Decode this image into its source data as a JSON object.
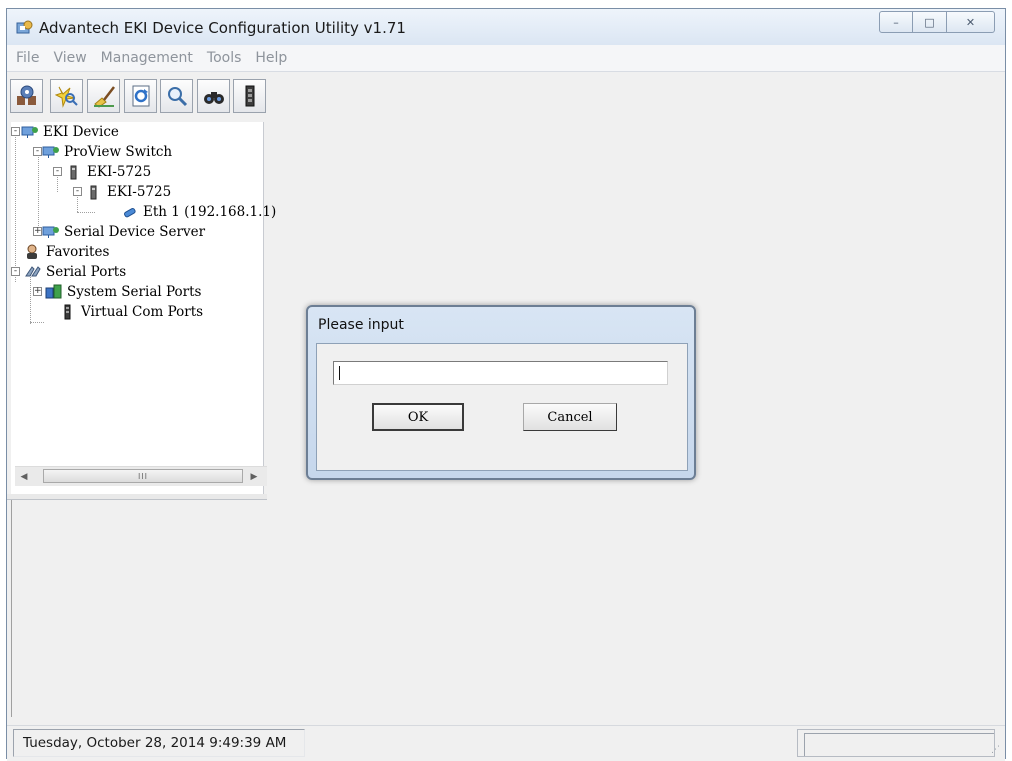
{
  "window": {
    "title": "Advantech EKI Device Configuration Utility v1.71",
    "controls": {
      "minimize": "–",
      "maximize": "□",
      "close": "✕"
    }
  },
  "menubar": {
    "items": [
      "File",
      "View",
      "Management",
      "Tools",
      "Help"
    ]
  },
  "toolbar": {
    "buttons": [
      "devices-icon",
      "search-icon",
      "clear-icon",
      "refresh-icon",
      "zoom-icon",
      "locate-icon",
      "serial-icon"
    ]
  },
  "tree": {
    "items": [
      {
        "label": "EKI Device",
        "icon": "network-icon"
      },
      {
        "label": "ProView Switch",
        "icon": "network-icon"
      },
      {
        "label": "EKI-5725",
        "icon": "switch-icon"
      },
      {
        "label": "EKI-5725",
        "icon": "switch-icon"
      },
      {
        "label": "Eth 1 (192.168.1.1)",
        "icon": "ethernet-icon"
      },
      {
        "label": "Serial Device Server",
        "icon": "network-icon"
      },
      {
        "label": "Favorites",
        "icon": "favorites-icon"
      },
      {
        "label": "Serial Ports",
        "icon": "serial-icon"
      },
      {
        "label": "System Serial Ports",
        "icon": "system-ports-icon"
      },
      {
        "label": "Virtual Com Ports",
        "icon": "virtual-port-icon"
      }
    ]
  },
  "scrollbar": {
    "thumb_text": "III"
  },
  "statusbar": {
    "datetime": "Tuesday, October 28, 2014  9:49:39 AM"
  },
  "dialog": {
    "title": "Please input",
    "input_value": "",
    "ok_label": "OK",
    "cancel_label": "Cancel"
  },
  "colors": {
    "titlebar": "#dbe6f3",
    "dialog_frame": "#c6d7ec",
    "window_bg": "#f0f0f0"
  }
}
